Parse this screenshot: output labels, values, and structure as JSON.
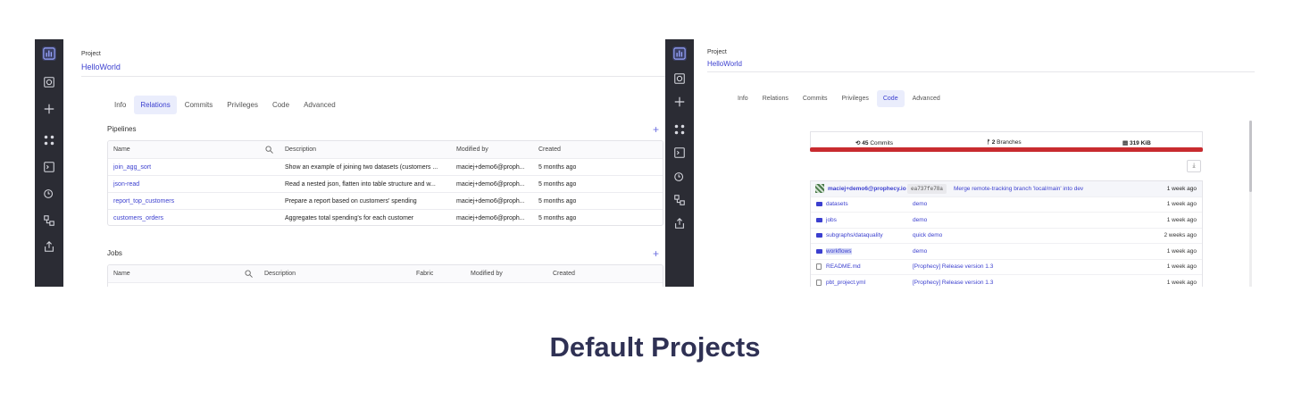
{
  "caption": "Default Projects",
  "left": {
    "project_label": "Project",
    "project_name": "HelloWorld",
    "tabs": [
      "Info",
      "Relations",
      "Commits",
      "Privileges",
      "Code",
      "Advanced"
    ],
    "active_tab": "Relations",
    "pipelines": {
      "title": "Pipelines",
      "headers": [
        "Name",
        "Description",
        "Modified by",
        "Created"
      ],
      "rows": [
        [
          "join_agg_sort",
          "Show an example of joining two datasets (customers ...",
          "maciej+demo6@proph...",
          "5 months ago"
        ],
        [
          "json-read",
          "Read a nested json, flatten into table structure and w...",
          "maciej+demo6@proph...",
          "5 months ago"
        ],
        [
          "report_top_customers",
          "Prepare a report based on customers' spending",
          "maciej+demo6@proph...",
          "5 months ago"
        ],
        [
          "customers_orders",
          "Aggregates total spending's for each customer",
          "maciej+demo6@proph...",
          "5 months ago"
        ]
      ]
    },
    "jobs": {
      "title": "Jobs",
      "headers": [
        "Name",
        "Description",
        "Fabric",
        "Modified by",
        "Created"
      ]
    }
  },
  "right": {
    "project_label": "Project",
    "project_name": "HelloWorld",
    "tabs": [
      "Info",
      "Relations",
      "Commits",
      "Privileges",
      "Code",
      "Advanced"
    ],
    "active_tab": "Code",
    "stats": {
      "commits_count": "45",
      "commits_label": "Commits",
      "branches_count": "2",
      "branches_label": "Branches",
      "size": "319 KiB"
    },
    "latest_commit": {
      "author": "maciej+demo6@prophecy.io",
      "hash": "ea737fe78a",
      "message": "Merge remote-tracking branch 'local/main' into dev",
      "date": "1 week ago"
    },
    "files": [
      {
        "name": "datasets",
        "type": "folder",
        "message": "demo",
        "date": "1 week ago"
      },
      {
        "name": "jobs",
        "type": "folder",
        "message": "demo",
        "date": "1 week ago"
      },
      {
        "name": "subgraphs/dataquality",
        "type": "folder",
        "message": "quick demo",
        "date": "2 weeks ago"
      },
      {
        "name": "workflows",
        "type": "folder",
        "message": "demo",
        "date": "1 week ago"
      },
      {
        "name": "README.md",
        "type": "file",
        "message": "[Prophecy] Release version 1.3",
        "date": "1 week ago"
      },
      {
        "name": "pbt_project.yml",
        "type": "file",
        "message": "[Prophecy] Release version 1.3",
        "date": "1 week ago"
      }
    ]
  },
  "colors": {
    "accent": "#3b3fcf",
    "rail": "#2b2c34",
    "commit_bar": "#c82b2f",
    "caption": "#2f3154"
  }
}
